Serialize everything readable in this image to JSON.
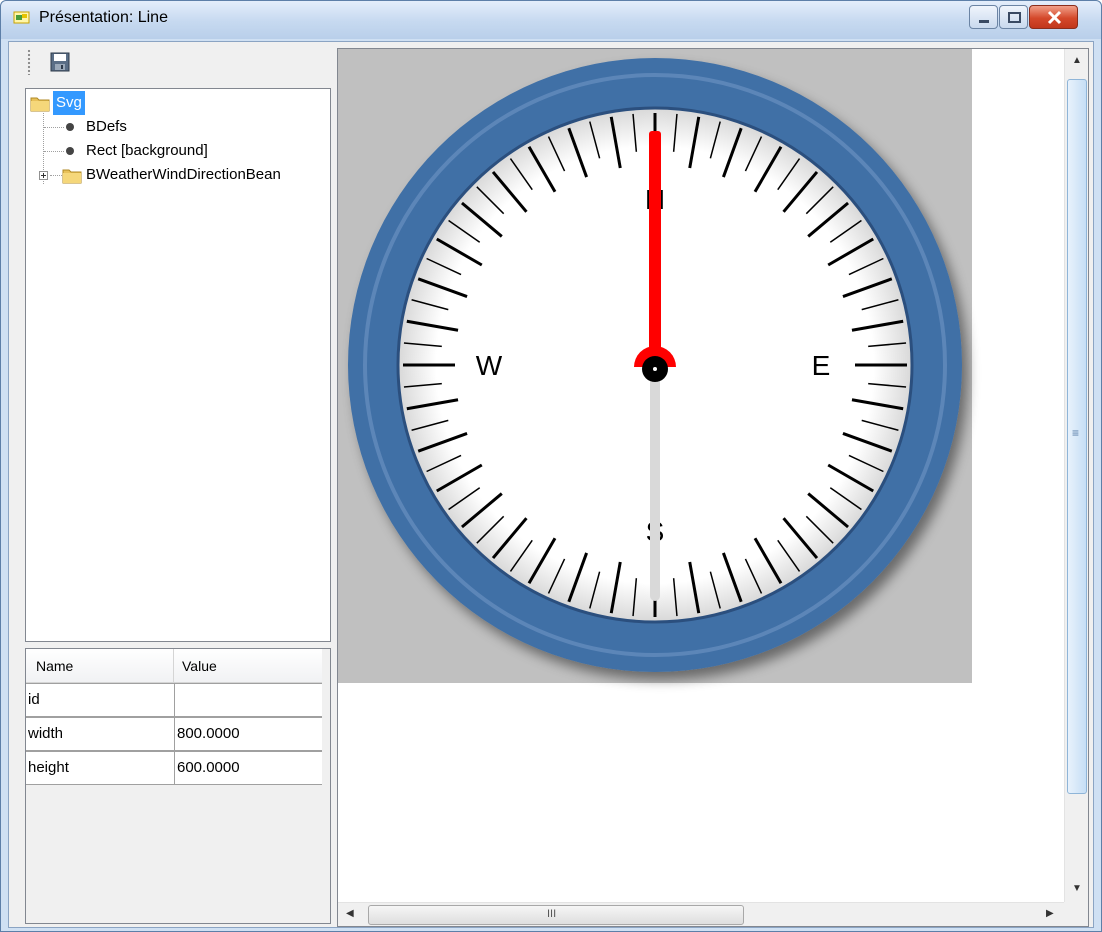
{
  "window": {
    "title": "Présentation: Line"
  },
  "toolbar": {
    "save_icon": "floppy-disk-icon"
  },
  "tree": {
    "root": {
      "label": "Svg",
      "icon": "folder-icon",
      "selected": true
    },
    "children": [
      {
        "label": "BDefs",
        "icon": "bullet-icon"
      },
      {
        "label": "Rect [background]",
        "icon": "bullet-icon"
      },
      {
        "label": "BWeatherWindDirectionBean",
        "icon": "folder-icon",
        "expandable": true
      }
    ]
  },
  "properties": {
    "columns": [
      "Name",
      "Value"
    ],
    "rows": [
      {
        "name": "id",
        "value": ""
      },
      {
        "name": "width",
        "value": "800.0000"
      },
      {
        "name": "height",
        "value": "600.0000"
      }
    ]
  },
  "compass": {
    "labels": {
      "n": "N",
      "e": "E",
      "s": "S",
      "w": "W"
    },
    "needle_direction_deg": 0,
    "colors": {
      "bezel": "#3f6fa6",
      "needle_north": "#ff0000",
      "needle_south": "#d9d9d9",
      "background": "#c0c0c0"
    }
  },
  "scrollbars": {
    "h_grip": "III",
    "v_grip": "≡"
  }
}
